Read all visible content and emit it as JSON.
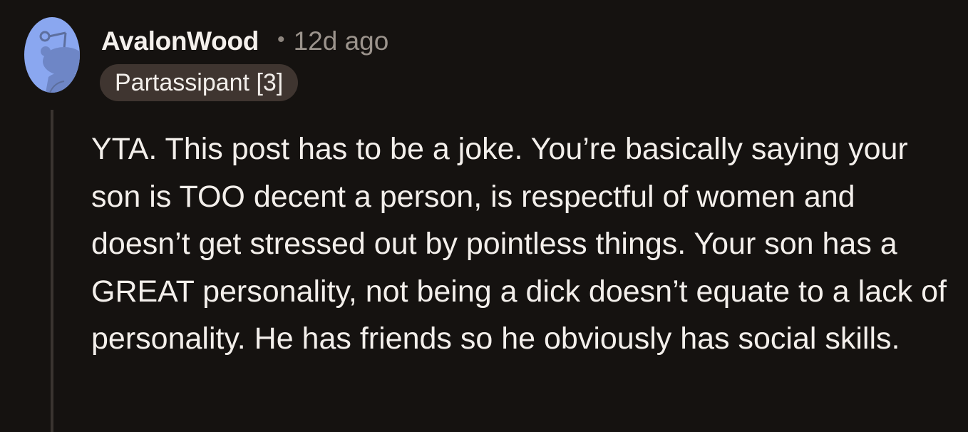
{
  "comment": {
    "author": "AvalonWood",
    "separator": "•",
    "age": "12d ago",
    "flair": "Partassipant [3]",
    "avatar_icon": "reddit-snoo-avatar-icon",
    "body": "YTA. This post has to be a joke. You’re basically saying your son is TOO decent a person, is respectful of women and doesn’t get stressed out by pointless things. Your son has a GREAT personality, not being a dick doesn’t equate to a lack of personality. He has friends so he obviously has social skills."
  },
  "colors": {
    "background": "#151210",
    "avatar": "#8aa7f0",
    "flair_bg": "#3f3530",
    "thread_line": "#3a3430",
    "meta_text": "#9b938c"
  }
}
